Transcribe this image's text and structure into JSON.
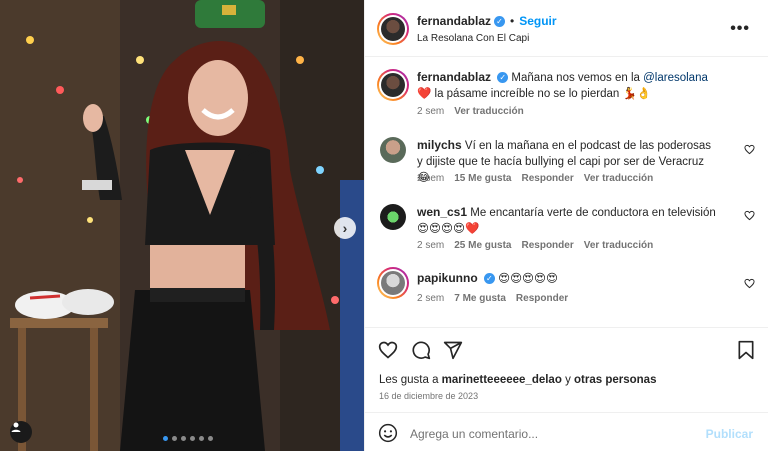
{
  "post": {
    "author": "fernandablaz",
    "follow_label": "Seguir",
    "separator": "•",
    "location": "La Resolana Con El Capi",
    "more_label": "•••",
    "caption_pre": "Mañana nos vemos en la",
    "caption_mention": "@laresolana",
    "caption_post": "❤️ la pásame increíble no se lo pierdan 💃👌",
    "caption_time": "2 sem",
    "caption_translate": "Ver traducción",
    "carousel_total": 6,
    "carousel_active": 1
  },
  "comments": [
    {
      "user": "milychs",
      "text": "Ví en la mañana en el podcast de las poderosas y dijiste que te hacía bullying el capi por ser de Veracruz 😂",
      "time": "2 sem",
      "likes": "15 Me gusta",
      "reply": "Responder",
      "translate": "Ver traducción"
    },
    {
      "user": "wen_cs1",
      "text": "Me encantaría verte de conductora en televisión 😍😍😍😍❤️",
      "time": "2 sem",
      "likes": "25 Me gusta",
      "reply": "Responder",
      "translate": "Ver traducción"
    },
    {
      "user": "papikunno",
      "text": "😍😍😍😍😍",
      "time": "2 sem",
      "likes": "7 Me gusta",
      "reply": "Responder"
    }
  ],
  "engagement": {
    "likes_pre": "Les gusta a",
    "likes_user": "marinetteeeeee_delao",
    "likes_mid": "y",
    "likes_others": "otras personas",
    "date": "16 de diciembre de 2023"
  },
  "composer": {
    "placeholder": "Agrega un comentario...",
    "publish_label": "Publicar"
  },
  "colors": {
    "link_blue": "#0095f6",
    "verified_blue": "#3897f0",
    "mention": "#00376b",
    "heart_red": "#ed4956"
  },
  "icons": [
    "heart-icon",
    "comment-icon",
    "share-icon",
    "bookmark-icon",
    "emoji-icon",
    "verified-icon",
    "more-icon",
    "chevron-right-icon",
    "user-tag-icon"
  ]
}
